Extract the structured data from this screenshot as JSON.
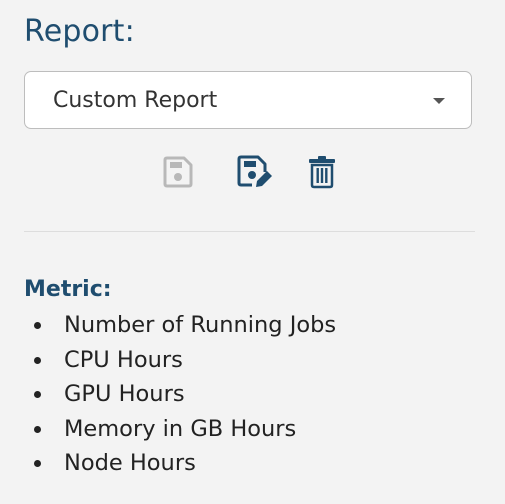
{
  "report": {
    "heading": "Report:",
    "selected": "Custom Report"
  },
  "toolbar": {
    "save_icon": "floppy-disk-icon",
    "save_as_icon": "floppy-disk-pen-icon",
    "delete_icon": "trash-can-icon",
    "save_enabled": false
  },
  "metric": {
    "heading": "Metric:",
    "items": [
      "Number of Running Jobs",
      "CPU Hours",
      "GPU Hours",
      "Memory in GB Hours",
      "Node Hours"
    ]
  },
  "colors": {
    "accent": "#1f4d6f",
    "disabled_icon": "#b8b8b8",
    "background": "#f3f3f3"
  }
}
